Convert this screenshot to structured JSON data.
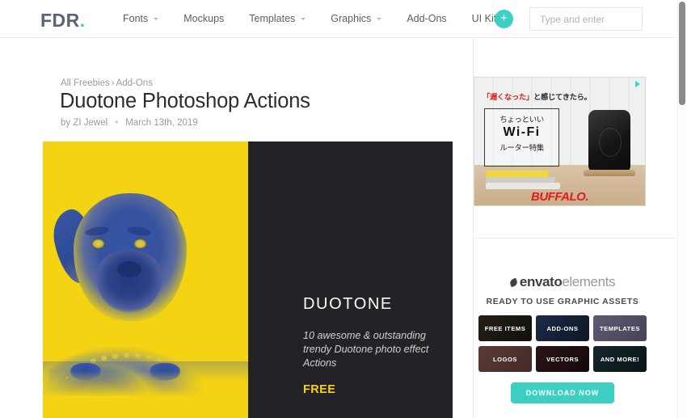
{
  "header": {
    "logo_text": "FDR",
    "logo_dot": ".",
    "nav_items": [
      {
        "label": "Fonts",
        "has_caret": true
      },
      {
        "label": "Mockups",
        "has_caret": false
      },
      {
        "label": "Templates",
        "has_caret": true
      },
      {
        "label": "Graphics",
        "has_caret": true
      },
      {
        "label": "Add-Ons",
        "has_caret": false
      },
      {
        "label": "UI Kits",
        "has_caret": false
      }
    ],
    "plus_label": "+",
    "search_placeholder": "Type and enter",
    "search_value": ""
  },
  "social": {
    "items": [
      {
        "name": "pinterest",
        "color": "#cb2027"
      },
      {
        "name": "facebook",
        "color": "#3b5998"
      },
      {
        "name": "twitter",
        "color": "#1da1f2"
      }
    ]
  },
  "article": {
    "breadcrumb_root": "All Freebies",
    "breadcrumb_sep": "›",
    "breadcrumb_current": "Add-Ons",
    "title": "Duotone Photoshop Actions",
    "author_prefix": "by",
    "author": "ZI Jewel",
    "meta_sep": "•",
    "date": "March 13th, 2019"
  },
  "hero": {
    "duotone_title": "DUOTONE",
    "duotone_description": "10 awesome & outstanding trendy Duotone photo effect Actions",
    "free_label": "FREE",
    "yellow": "#f4d313",
    "blue": "#2f4c9c",
    "dark_panel": "#232327"
  },
  "sidebar": {
    "ad": {
      "headline_red": "「遅くなった」",
      "headline_rest": "と感じてきたら。",
      "box_line1": "ちょっといい",
      "box_line2": "Wi-Fi",
      "box_line3": "ルーター特集",
      "brand": "BUFFALO.",
      "adchoices_label": "AdChoices"
    },
    "envato": {
      "logo_bold": "envato",
      "logo_light": "elements",
      "subtitle": "READY TO USE GRAPHIC ASSETS",
      "tiles": [
        "FREE ITEMS",
        "ADD-ONS",
        "TEMPLATES",
        "LOGOS",
        "VECTORS",
        "AND MORE!"
      ],
      "download_label": "DOWNLOAD NOW",
      "accent_color": "#3ecfc4"
    }
  }
}
